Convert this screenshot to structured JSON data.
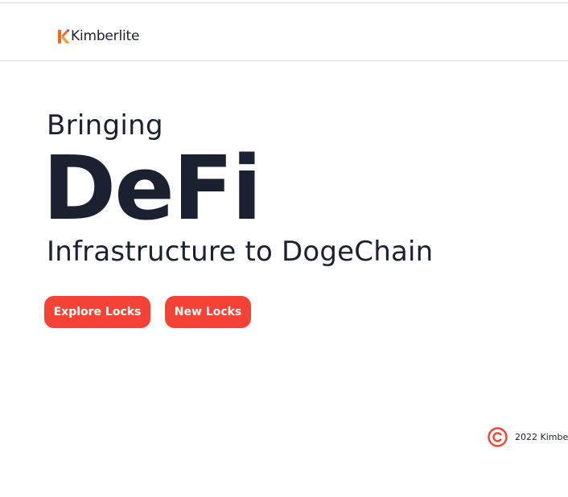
{
  "header": {
    "brand_name": "Kimberlite",
    "logo_icon": "kimberlite-k-logo-icon",
    "brand_color": "#f26a21"
  },
  "hero": {
    "kicker": "Bringing",
    "title": "DeFi",
    "subtitle": "Infrastructure to DogeChain"
  },
  "actions": {
    "explore_label": "Explore Locks",
    "new_label": "New Locks",
    "button_color": "#f44336"
  },
  "footer": {
    "copyright_icon": "copyright-icon",
    "copyright_text": "2022 Kimbe"
  }
}
